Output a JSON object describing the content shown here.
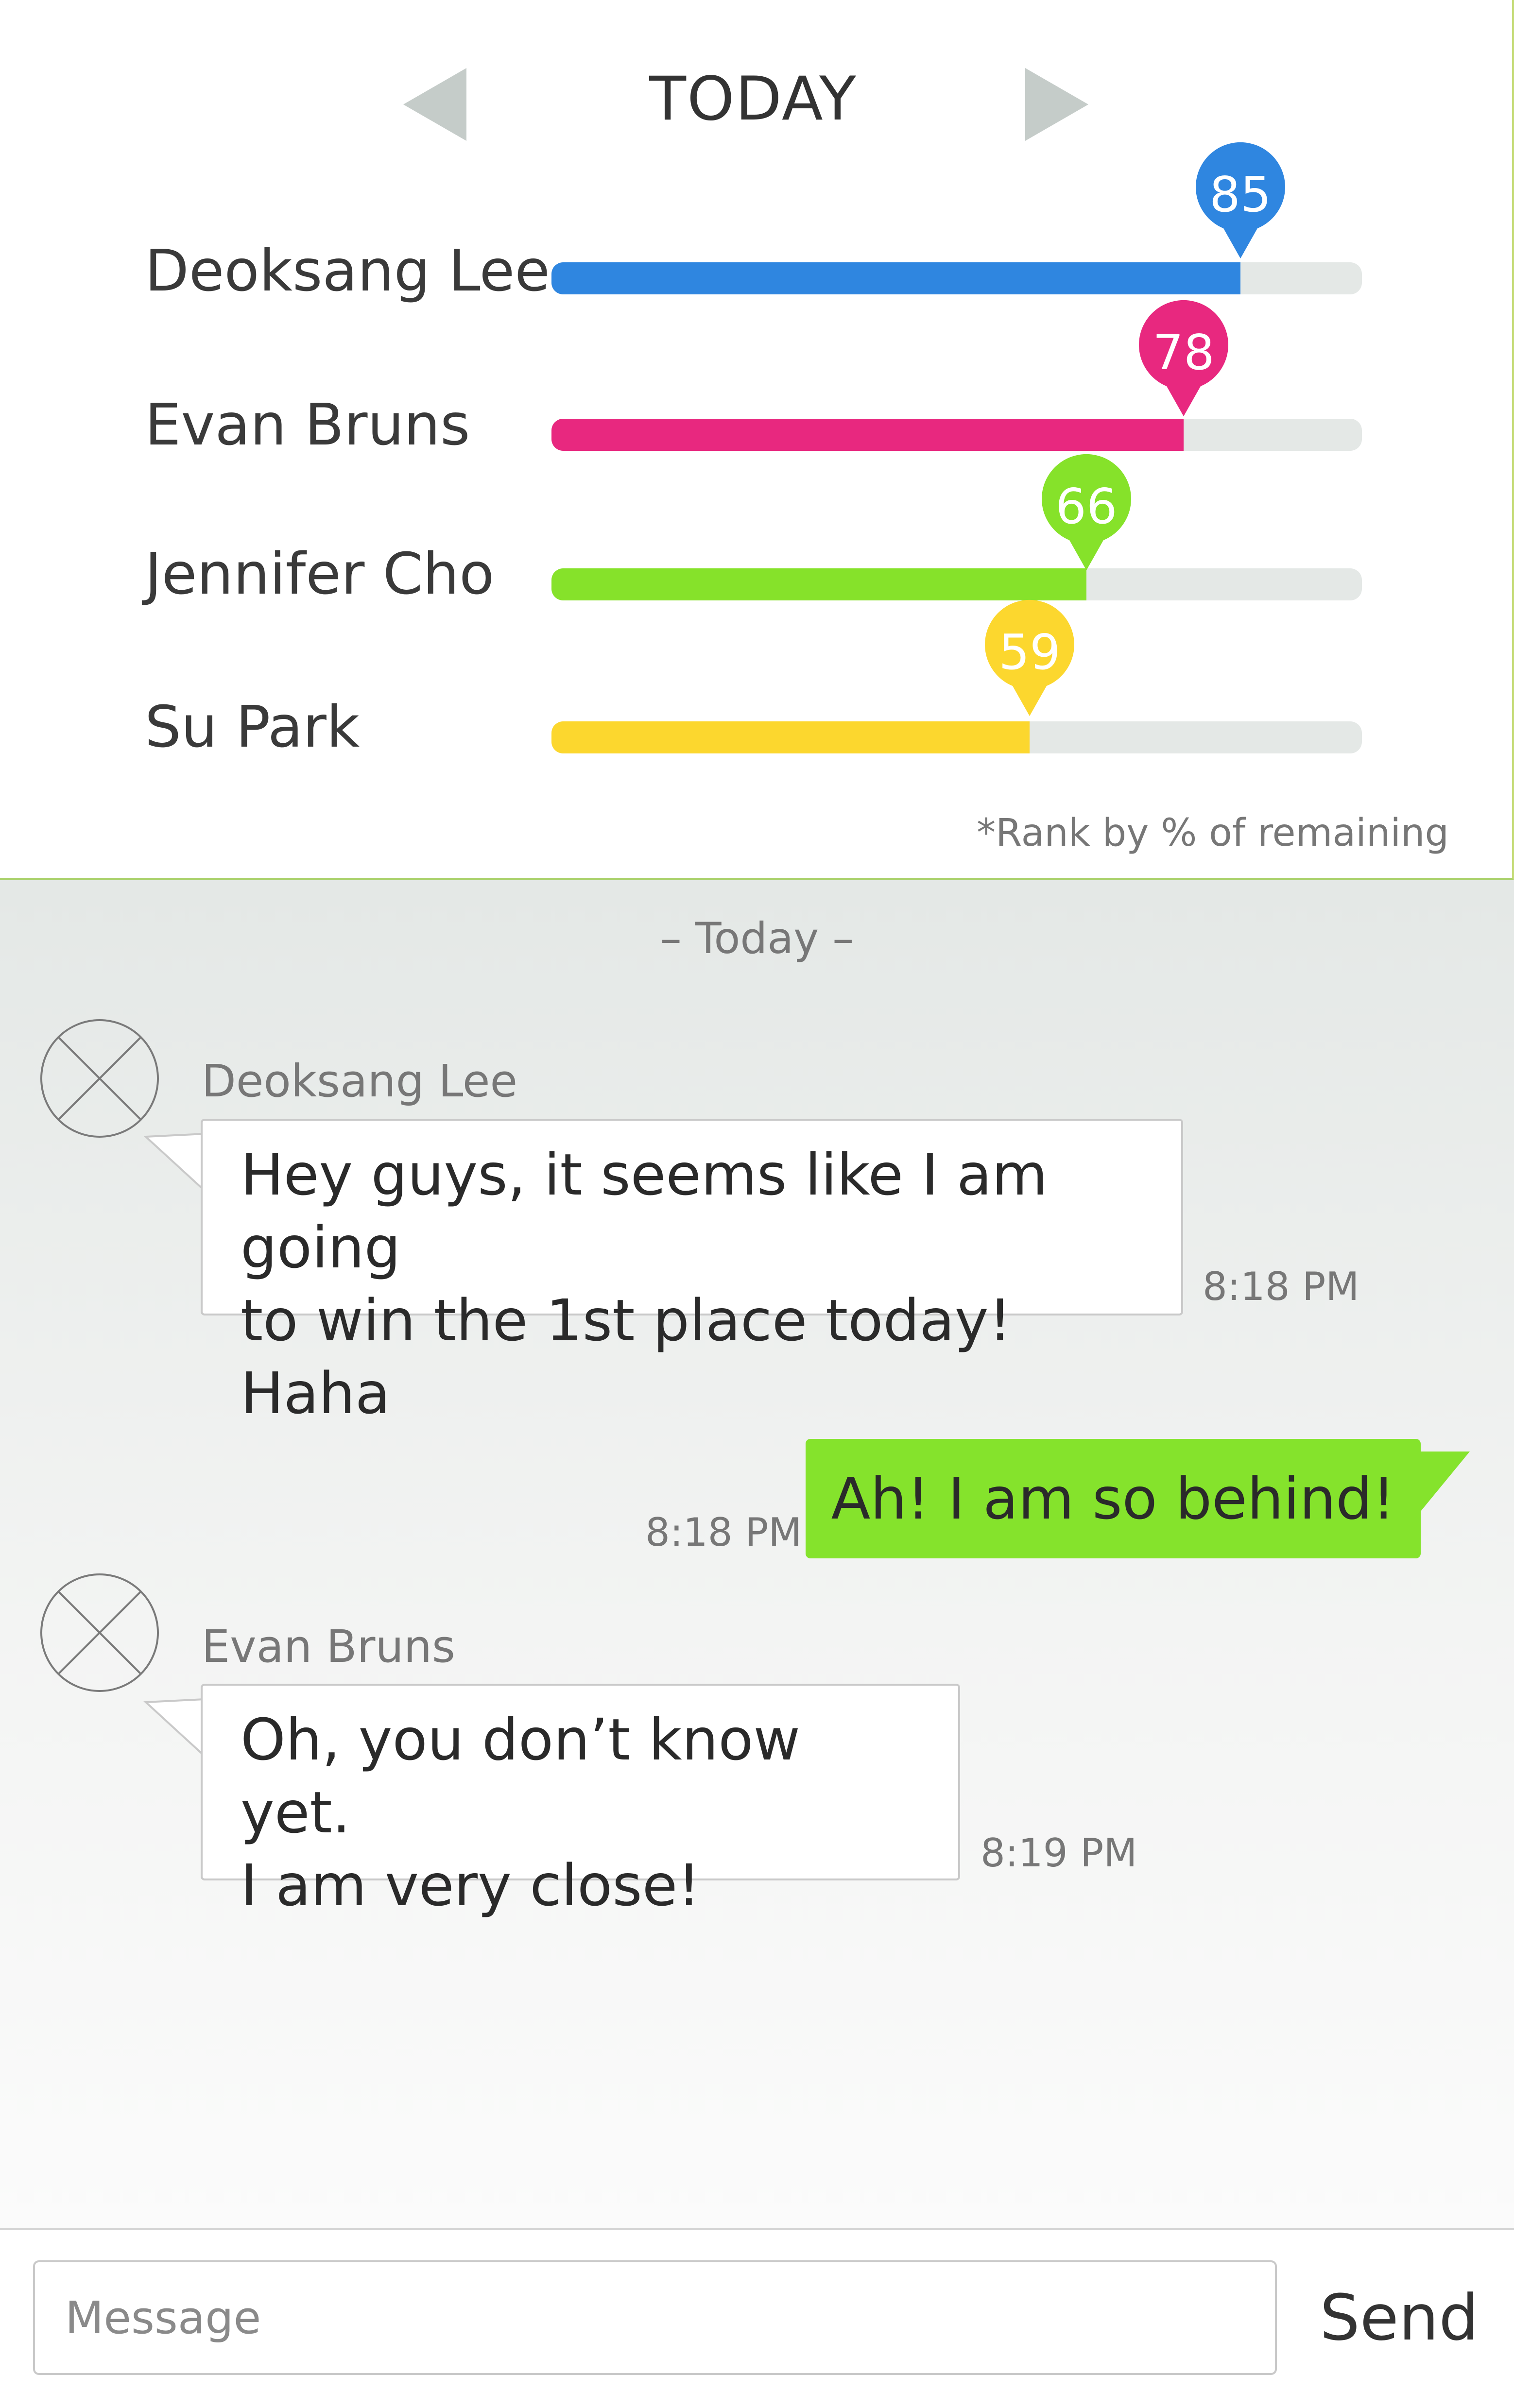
{
  "ranking": {
    "period": "TODAY",
    "entries": [
      {
        "name": "Deoksang Lee",
        "value": 85,
        "color": "#2f86e0"
      },
      {
        "name": "Evan Bruns",
        "value": 78,
        "color": "#e8287f"
      },
      {
        "name": "Jennifer Cho",
        "value": 66,
        "color": "#86e22a"
      },
      {
        "name": "Su Park",
        "value": 59,
        "color": "#fcd72e"
      }
    ],
    "footnote": "*Rank by % of remaining"
  },
  "chat": {
    "divider": "– Today –",
    "messages": [
      {
        "sender": "Deoksang Lee",
        "text_lines": [
          "Hey guys, it seems like I am going",
          "to win the 1st place today! Haha"
        ],
        "time": "8:18 PM",
        "outgoing": false
      },
      {
        "text_lines": [
          "Ah! I am so behind!"
        ],
        "time": "8:18 PM",
        "outgoing": true
      },
      {
        "sender": "Evan Bruns",
        "text_lines": [
          "Oh, you don’t know yet.",
          "I am very close!"
        ],
        "time": "8:19 PM",
        "outgoing": false
      }
    ]
  },
  "input": {
    "placeholder": "Message",
    "send_label": "Send"
  },
  "colors": {
    "outgoing_bubble": "#85e32c",
    "nav_arrow": "#c5ccc9",
    "track": "#e4e8e6"
  },
  "icons": {
    "prev": "triangle-left-icon",
    "next": "triangle-right-icon",
    "avatar": "avatar-placeholder-icon"
  }
}
